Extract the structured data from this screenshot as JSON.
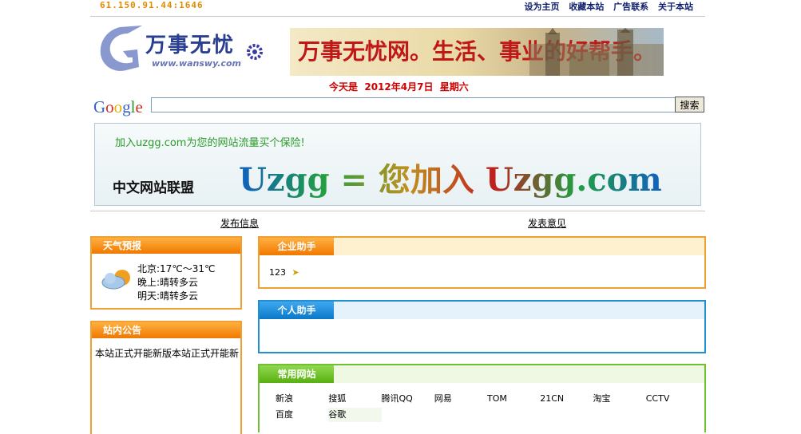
{
  "header": {
    "ip": "61.150.91.44:1646",
    "links": [
      "设为主页",
      "收藏本站",
      "广告联系",
      "关于本站"
    ]
  },
  "logo": {
    "title": "万事无忧",
    "url": "www.wanswy.com"
  },
  "banner": {
    "text": "万事无忧网。生活、事业的好帮手。"
  },
  "date_line": "今天是  2012年4月7日  星期六",
  "search": {
    "brand": "Google",
    "placeholder": "",
    "button": "搜索"
  },
  "ad": {
    "tagline": "加入uzgg.com为您的网站流量买个保险!",
    "name": "中文网站联盟",
    "big_text": "Uzgg = 您加入 Uzgg.com"
  },
  "nav": {
    "publish": "发布信息",
    "feedback": "发表意见"
  },
  "weather": {
    "title": "天气预报",
    "lines": [
      "北京:17℃～31℃",
      "晚上:晴转多云",
      "明天:晴转多云"
    ]
  },
  "notice": {
    "title": "站内公告",
    "text": "本站正式开能新版本站正式开能新"
  },
  "enterprise": {
    "title": "企业助手",
    "item": "123"
  },
  "personal": {
    "title": "个人助手"
  },
  "common_sites": {
    "title": "常用网站",
    "links": [
      "新浪",
      "搜狐",
      "腾讯QQ",
      "网易",
      "TOM",
      "21CN",
      "淘宝",
      "CCTV",
      "百度",
      "谷歌"
    ]
  },
  "colors": {
    "orange": "#f08a10",
    "blue": "#1c8ed8",
    "green": "#6cc020"
  }
}
